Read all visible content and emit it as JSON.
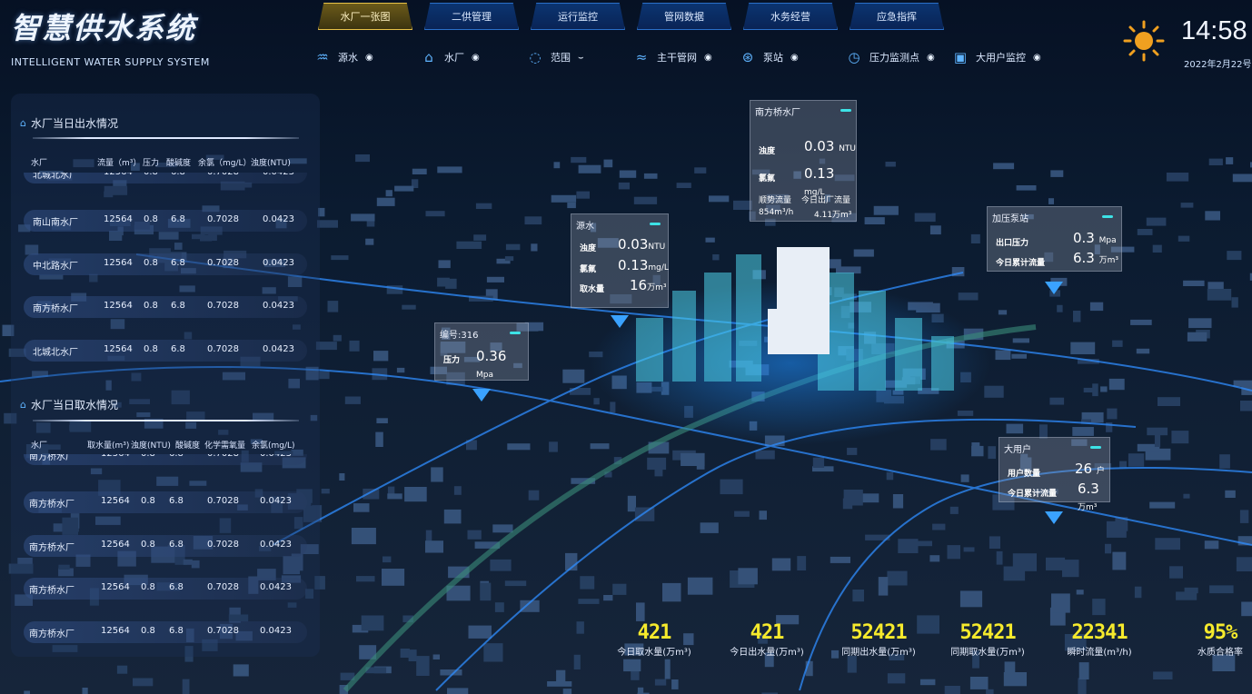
{
  "header": {
    "title": "智慧供水系统",
    "subtitle": "INTELLIGENT WATER SUPPLY SYSTEM",
    "time": "14:58",
    "date": "2022年2月22号"
  },
  "tabs": [
    {
      "label": "水厂一张图",
      "active": true
    },
    {
      "label": "二供管理"
    },
    {
      "label": "运行监控"
    },
    {
      "label": "管网数据"
    },
    {
      "label": "水务经营"
    },
    {
      "label": "应急指挥"
    }
  ],
  "layers": [
    {
      "label": "源水",
      "icon": "source-water-icon"
    },
    {
      "label": "水厂",
      "icon": "water-plant-icon"
    },
    {
      "label": "范围",
      "icon": "range-icon"
    },
    {
      "label": "主干管网",
      "icon": "pipe-network-icon"
    },
    {
      "label": "泵站",
      "icon": "pump-station-icon"
    },
    {
      "label": "压力监测点",
      "icon": "pressure-gauge-icon"
    },
    {
      "label": "大用户监控",
      "icon": "big-user-icon"
    }
  ],
  "outflow_panel": {
    "title": "水厂当日出水情况",
    "headers": [
      "水厂",
      "流量（m³）",
      "压力",
      "酸碱度",
      "余氯（mg/L）",
      "浊度(NTU)"
    ],
    "partial_row": [
      "北城北水厂",
      "12564",
      "0.8",
      "6.8",
      "0.7028",
      "0.0423"
    ],
    "rows": [
      [
        "南山南水厂",
        "12564",
        "0.8",
        "6.8",
        "0.7028",
        "0.0423"
      ],
      [
        "中北路水厂",
        "12564",
        "0.8",
        "6.8",
        "0.7028",
        "0.0423"
      ],
      [
        "南方桥水厂",
        "12564",
        "0.8",
        "6.8",
        "0.7028",
        "0.0423"
      ],
      [
        "北城北水厂",
        "12564",
        "0.8",
        "6.8",
        "0.7028",
        "0.0423"
      ]
    ]
  },
  "intake_panel": {
    "title": "水厂当日取水情况",
    "headers": [
      "水厂",
      "取水量(m³)",
      "浊度(NTU)",
      "酸碱度",
      "化学需氧量",
      "余氯(mg/L)"
    ],
    "partial_row": [
      "南方桥水厂",
      "12564",
      "0.8",
      "6.8",
      "0.7028",
      "0.0423"
    ],
    "rows": [
      [
        "南方桥水厂",
        "12564",
        "0.8",
        "6.8",
        "0.7028",
        "0.0423"
      ],
      [
        "南方桥水厂",
        "12564",
        "0.8",
        "6.8",
        "0.7028",
        "0.0423"
      ],
      [
        "南方桥水厂",
        "12564",
        "0.8",
        "6.8",
        "0.7028",
        "0.0423"
      ],
      [
        "南方桥水厂",
        "12564",
        "0.8",
        "6.8",
        "0.7028",
        "0.0423"
      ]
    ]
  },
  "cards": {
    "plant": {
      "title": "南方桥水厂",
      "turbidity_label": "浊度",
      "turbidity_value": "0.03",
      "turbidity_unit": "NTU",
      "chlorine_label": "氯氟",
      "chlorine_value": "0.13",
      "chlorine_unit": "mg/L",
      "flow_label": "顺势流量",
      "flow_value": "854m³/h",
      "today_label": "今日出厂流量",
      "today_value": "4.11万m³"
    },
    "source": {
      "title": "源水",
      "turbidity_label": "浊度",
      "turbidity_value": "0.03",
      "turbidity_unit": "NTU",
      "chlorine_label": "氯氟",
      "chlorine_value": "0.13",
      "chlorine_unit": "mg/L",
      "intake_label": "取水量",
      "intake_value": "16",
      "intake_unit": "万m³"
    },
    "pressure_point": {
      "title": "编号:316",
      "pressure_label": "压力",
      "pressure_value": "0.36",
      "pressure_unit": "Mpa"
    },
    "booster": {
      "title": "加压泵站",
      "out_label": "出口压力",
      "out_value": "0.3",
      "out_unit": "Mpa",
      "flow_label": "今日累计流量",
      "flow_value": "6.3",
      "flow_unit": "万m³"
    },
    "big_user": {
      "title": "大用户",
      "count_label": "用户数量",
      "count_value": "26",
      "count_unit": "户",
      "flow_label": "今日累计流量",
      "flow_value": "6.3",
      "flow_unit": "万m³"
    }
  },
  "stats": [
    {
      "value": "421",
      "label": "今日取水量(万m³)"
    },
    {
      "value": "421",
      "label": "今日出水量(万m³)"
    },
    {
      "value": "52421",
      "label": "同期出水量(万m³)"
    },
    {
      "value": "52421",
      "label": "同期取水量(万m³)"
    },
    {
      "value": "22341",
      "label": "瞬时流量(m³/h)"
    },
    {
      "value": "95%",
      "label": "水质合格率"
    }
  ],
  "colors": {
    "accent": "#5fb4ff",
    "active_tab": "#e8c247",
    "stat_value": "#f6ea2c",
    "card_bar": "#3de2e6"
  }
}
